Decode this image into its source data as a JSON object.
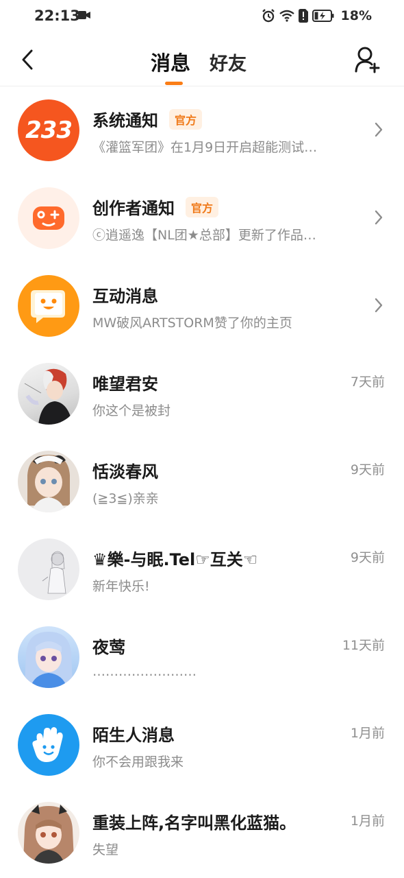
{
  "status_bar": {
    "time": "22:13",
    "battery_percent": "18%"
  },
  "header": {
    "tabs": [
      {
        "label": "消息",
        "active": true
      },
      {
        "label": "好友",
        "active": false
      }
    ],
    "accent_color": "#fa7d16"
  },
  "messages": [
    {
      "name": "系统通知",
      "badge": "官方",
      "preview": "《灌篮军团》在1月9日开启超能测试…",
      "avatar_label": "233",
      "avatar_color": "#f5561f"
    },
    {
      "name": "创作者通知",
      "badge": "官方",
      "preview": "ⓒ逍遥逸【NL团★总部】更新了作品…",
      "avatar_icon": "gamepad-icon",
      "avatar_color": "#ff6a2c"
    },
    {
      "name": "互动消息",
      "preview": "MW破风ARTSTORM赞了你的主页",
      "avatar_icon": "chat-face-icon",
      "avatar_color": "#ff8f12"
    },
    {
      "name": "唯望君安",
      "time": "7天前",
      "preview": "你这个是被封"
    },
    {
      "name": "恬淡春风",
      "time": "9天前",
      "preview": "(≧3≦)亲亲"
    },
    {
      "name": "♛樂-与眠.Tel☞互关☜",
      "time": "9天前",
      "preview": "新年快乐!"
    },
    {
      "name": "夜莺",
      "time": "11天前",
      "preview": "……………………"
    },
    {
      "name": "陌生人消息",
      "time": "1月前",
      "preview": "你不会用跟我来",
      "avatar_icon": "hand-wave-icon",
      "avatar_color": "#1e9bf0"
    },
    {
      "name": "重装上阵,名字叫黑化蓝猫。",
      "time": "1月前",
      "preview": "失望"
    }
  ]
}
